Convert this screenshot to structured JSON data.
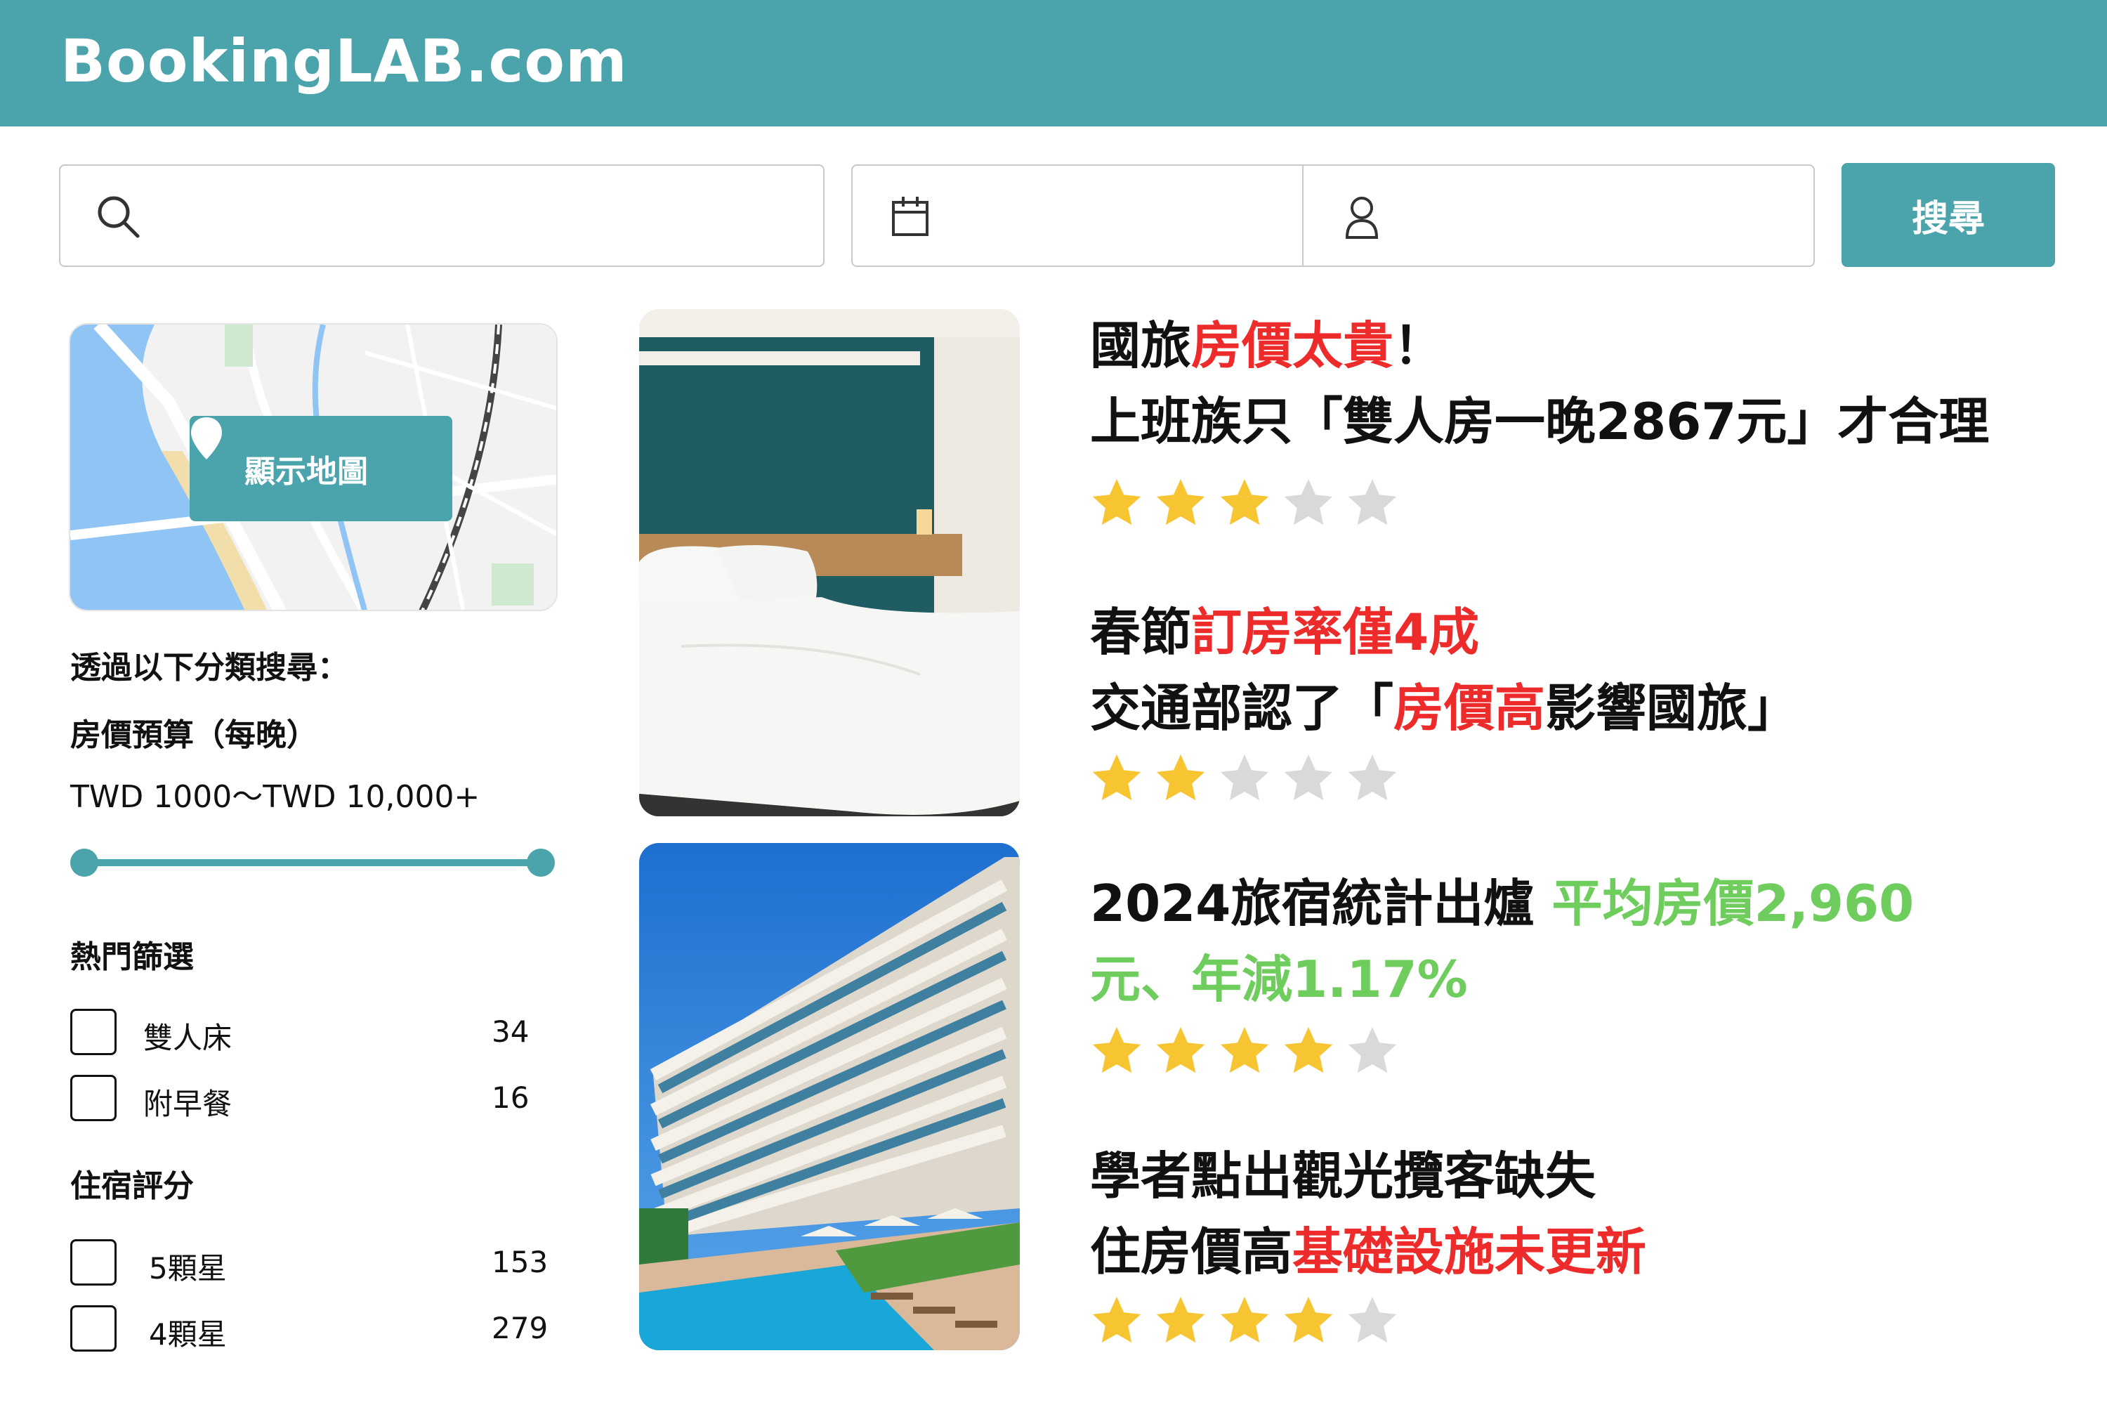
{
  "header": {
    "logo": "BookingLAB.com"
  },
  "search": {
    "icon": "search-icon",
    "date_icon": "calendar-icon",
    "guest_icon": "user-icon",
    "button_label": "搜尋"
  },
  "map": {
    "button_label": "顯示地圖",
    "pin_icon": "map-pin-icon"
  },
  "sidebar": {
    "browse_by": "透過以下分類搜尋：",
    "budget_title": "房價預算（每晚）",
    "price_range": "TWD 1000～TWD 10,000+",
    "slider_range_selected": [
      0,
      1
    ],
    "popular_title": "熱門篩選",
    "popular": [
      {
        "label": "雙人床",
        "count": "34"
      },
      {
        "label": "附早餐",
        "count": "16"
      }
    ],
    "rating_title": "住宿評分",
    "ratings": [
      {
        "label": "5顆星",
        "count": "153"
      },
      {
        "label": "4顆星",
        "count": "279"
      }
    ]
  },
  "articles": [
    {
      "line1_a": "國旅",
      "line1_b": "房價太貴",
      "line1_c": "！",
      "line2": "上班族只「雙人房一晚2867元」才合理",
      "rating": 3
    },
    {
      "line1_a": "春節",
      "line1_b": "訂房率僅4成",
      "line2_a": "交通部認了「",
      "line2_b": "房價高",
      "line2_c": "影響國旅」",
      "rating": 2
    },
    {
      "line1_a": "2024旅宿統計出爐 ",
      "line1_b": "平均房價2,960",
      "line2": "元、年減1.17%",
      "rating": 4
    },
    {
      "line1": "學者點出觀光攬客缺失",
      "line2_a": "住房價高",
      "line2_b": "基礎設施未更新",
      "rating": 4
    }
  ],
  "colors": {
    "brand": "#4ba3ab",
    "highlight_red": "#ee2b2b",
    "highlight_green": "#6fcd5d",
    "star_on": "#f7c432",
    "star_off": "#d9d9d9"
  }
}
